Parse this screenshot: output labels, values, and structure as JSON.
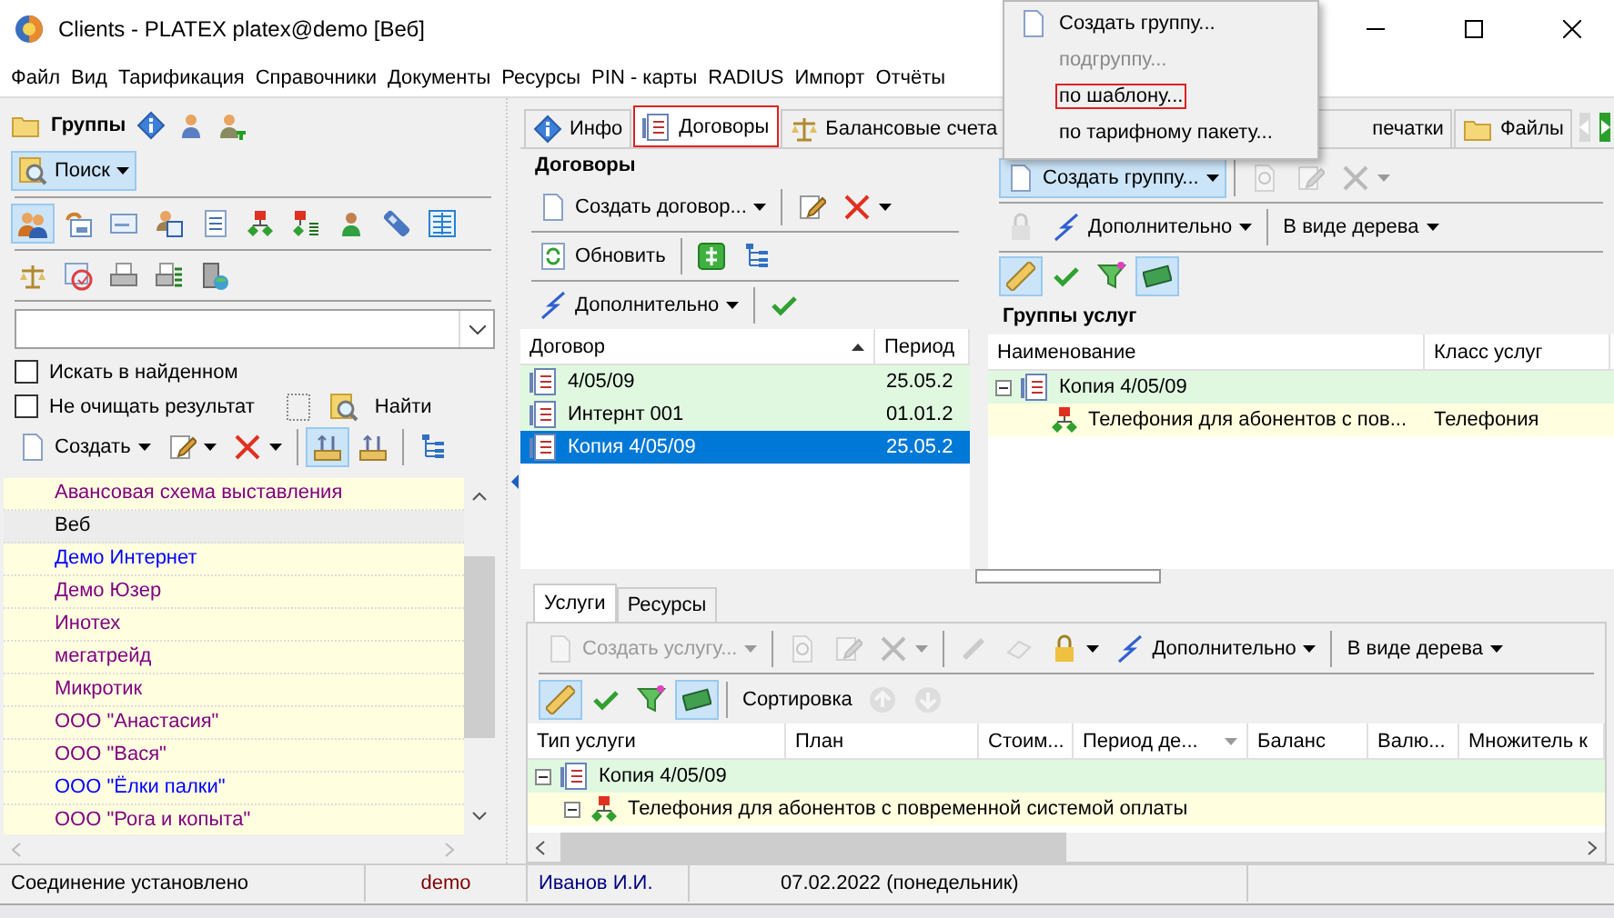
{
  "window": {
    "title": "Clients - PLATEX platex@demo [Веб]"
  },
  "menu": [
    "Файл",
    "Вид",
    "Тарификация",
    "Справочники",
    "Документы",
    "Ресурсы",
    "PIN - карты",
    "RADIUS",
    "Импорт",
    "Отчёты"
  ],
  "popup_menu": [
    {
      "label": "Создать группу...",
      "kind": "doc",
      "disabled": false,
      "marked": false
    },
    {
      "label": "подгруппу...",
      "disabled": true,
      "marked": false
    },
    {
      "label": "по шаблону...",
      "disabled": false,
      "marked": true
    },
    {
      "label": "по тарифному пакету...",
      "disabled": false,
      "marked": false
    }
  ],
  "groups_panel": {
    "title": "Группы",
    "header_tools": [
      {
        "kind": "info"
      },
      {
        "kind": "person"
      },
      {
        "kind": "person-t"
      }
    ],
    "search_toolbar": [
      [
        {
          "label": "Поиск",
          "kind": "search",
          "selected": true,
          "dropdown": true
        }
      ]
    ],
    "tool_rows": [
      [
        [
          {
            "kind": "people",
            "selected": true
          },
          {
            "kind": "calendar",
            "selected": false
          },
          {
            "kind": "card",
            "selected": false
          },
          {
            "kind": "person-card",
            "selected": false
          },
          {
            "kind": "doclist",
            "selected": false
          },
          {
            "kind": "diagram",
            "selected": false
          },
          {
            "kind": "diagramlist",
            "selected": false
          },
          {
            "kind": "person-green",
            "selected": false
          },
          {
            "kind": "phone",
            "selected": false
          },
          {
            "kind": "table",
            "selected": false
          }
        ]
      ],
      [
        [
          {
            "kind": "scales",
            "selected": false
          },
          {
            "kind": "checkdoc",
            "selected": false
          },
          {
            "kind": "printer",
            "selected": false
          },
          {
            "kind": "printerlist",
            "selected": false
          },
          {
            "kind": "server",
            "selected": false
          }
        ]
      ]
    ],
    "options": [
      {
        "label": "Искать в найденном",
        "checked": false
      },
      {
        "label": "Не очищать результат",
        "checked": false
      }
    ],
    "find_toolbar": [
      [
        {
          "kind": "dotted"
        },
        {
          "kind": "search"
        },
        {
          "label": "Найти"
        }
      ]
    ],
    "toolbar": [
      [
        {
          "label": "Создать",
          "kind": "doc",
          "dropdown": true
        },
        {
          "kind": "pencil",
          "dropdown": true
        },
        {
          "kind": "delete",
          "dropdown": true
        }
      ],
      [
        {
          "kind": "device",
          "selected": true
        },
        {
          "kind": "device",
          "selected": false
        }
      ],
      [
        {
          "kind": "tree"
        }
      ]
    ],
    "items": [
      {
        "name": "Авансовая схема выставления",
        "color": "#800080",
        "selected": false
      },
      {
        "name": "Веб",
        "color": "#000000",
        "selected": true
      },
      {
        "name": "Демо Интернет",
        "color": "#0000ff",
        "selected": false
      },
      {
        "name": "Демо Юзер",
        "color": "#800080",
        "selected": false
      },
      {
        "name": "Инотех",
        "color": "#800080",
        "selected": false
      },
      {
        "name": "мегатрейд",
        "color": "#800080",
        "selected": false
      },
      {
        "name": "Микротик",
        "color": "#800080",
        "selected": false
      },
      {
        "name": "ООО \"Анастасия\"",
        "color": "#800080",
        "selected": false
      },
      {
        "name": "ООО \"Вася\"",
        "color": "#800080",
        "selected": false
      },
      {
        "name": "ООО \"Ёлки палки\"",
        "color": "#0000ff",
        "selected": false
      },
      {
        "name": "ООО \"Рога и копыта\"",
        "color": "#800080",
        "selected": false
      }
    ]
  },
  "tabs": [
    {
      "label": "Инфо",
      "kind": "info",
      "selected": false,
      "marked": false
    },
    {
      "label": "Договоры",
      "kind": "contract",
      "selected": true,
      "marked": true
    },
    {
      "label": "Балансовые счета",
      "kind": "scales",
      "selected": false,
      "marked": false
    },
    {
      "label": "печатки",
      "selected": false,
      "marked": false
    },
    {
      "label": "Файлы",
      "kind": "folder",
      "selected": false,
      "marked": false
    }
  ],
  "tab_scroll": [
    {
      "disabled": true
    },
    {
      "disabled": false
    }
  ],
  "contracts": {
    "title": "Договоры",
    "toolbar": [
      [
        [
          {
            "label": "Создать договор...",
            "kind": "doc",
            "dropdown": true
          }
        ],
        [
          {
            "kind": "pencil"
          },
          {
            "kind": "delete",
            "dropdown": true
          }
        ]
      ],
      [
        [
          {
            "label": "Обновить",
            "kind": "refresh"
          }
        ],
        [
          {
            "kind": "cash"
          },
          {
            "kind": "tree"
          }
        ]
      ],
      [
        [
          {
            "label": "Дополнительно",
            "kind": "wand",
            "dropdown": true
          }
        ],
        [
          {
            "kind": "check"
          }
        ]
      ]
    ],
    "columns": [
      {
        "label": "Договор",
        "sort_arrow_up": true
      },
      {
        "label": "Период"
      }
    ],
    "rows": [
      {
        "cells": [
          "4/05/09",
          "25.05.2"
        ],
        "selected": false
      },
      {
        "cells": [
          "Интернт 001",
          "01.01.2"
        ],
        "selected": false
      },
      {
        "cells": [
          "Копия 4/05/09",
          "25.05.2"
        ],
        "selected": true
      }
    ]
  },
  "service_groups": {
    "toolbar": [
      [
        [
          {
            "label": "Создать группу...",
            "kind": "doc",
            "dropdown": true,
            "selected": true
          }
        ],
        [
          {
            "kind": "searchdoc",
            "disabled": true
          },
          {
            "kind": "pencil",
            "disabled": true
          },
          {
            "kind": "delete",
            "disabled": true,
            "dropdown": true
          }
        ]
      ],
      [
        [
          {
            "kind": "lock",
            "disabled": true
          },
          {
            "label": "Дополнительно",
            "kind": "wand",
            "dropdown": true
          }
        ],
        [
          {
            "label": "В виде дерева",
            "dropdown": true
          }
        ]
      ],
      [
        [
          {
            "kind": "ruler",
            "selected": true
          },
          {
            "kind": "check"
          },
          {
            "kind": "funnel",
            "selected": false
          },
          {
            "kind": "money",
            "selected": true
          }
        ]
      ]
    ],
    "title": "Группы услуг",
    "columns": [
      {
        "label": "Наименование"
      },
      {
        "label": "Класс услуг"
      }
    ],
    "tree": [
      {
        "cells": [
          "Копия 4/05/09"
        ],
        "expanded": true,
        "children": [
          {
            "cells": [
              "Телефония для абонентов с пов...",
              "Телефония"
            ]
          }
        ]
      }
    ]
  },
  "services": {
    "tabs": [
      {
        "label": "Услуги",
        "selected": true
      },
      {
        "label": "Ресурсы",
        "selected": false
      }
    ],
    "toolbar": [
      [
        [
          {
            "label": "Создать услугу...",
            "kind": "doc",
            "dropdown": true,
            "disabled": true
          }
        ],
        [
          {
            "kind": "searchdoc",
            "disabled": true
          },
          {
            "kind": "pencil",
            "disabled": true
          },
          {
            "kind": "delete",
            "disabled": true,
            "dropdown": true
          }
        ],
        [
          {
            "kind": "handset",
            "disabled": true
          },
          {
            "kind": "eraser",
            "disabled": true
          },
          {
            "kind": "lock",
            "disabled": false,
            "dropdown": true
          },
          {
            "label": "Дополнительно",
            "kind": "wand",
            "dropdown": true,
            "disabled": false
          }
        ],
        [
          {
            "label": "В виде дерева",
            "dropdown": true
          }
        ]
      ],
      [
        [
          {
            "kind": "ruler",
            "selected": true
          },
          {
            "kind": "check"
          },
          {
            "kind": "funnel",
            "selected": false
          },
          {
            "kind": "money",
            "selected": true
          }
        ],
        [
          {
            "label": "Сортировка",
            "disabled": false
          },
          {
            "kind": "up",
            "disabled": true
          },
          {
            "kind": "down",
            "disabled": true
          }
        ]
      ]
    ],
    "columns": [
      {
        "label": "Тип услуги"
      },
      {
        "label": "План"
      },
      {
        "label": "Стоим..."
      },
      {
        "label": "Период де...",
        "sort_arrow_up": false
      },
      {
        "label": "Баланс"
      },
      {
        "label": "Валю..."
      },
      {
        "label": "Множитель к"
      }
    ],
    "tree": [
      {
        "cells": [
          "Копия 4/05/09"
        ],
        "expanded": true,
        "children": [
          {
            "cells": [
              "Телефония для абонентов с повременной системой оплаты"
            ],
            "expanded": true
          }
        ]
      }
    ]
  },
  "status_bar": [
    {
      "text": "Соединение установлено",
      "color": "#000000"
    },
    {
      "text": "demo",
      "color": "#800000"
    },
    {
      "text": "Иванов И.И.",
      "color": "#000080"
    },
    {
      "text": "07.02.2022 (понедельник)",
      "color": "#000000"
    }
  ]
}
